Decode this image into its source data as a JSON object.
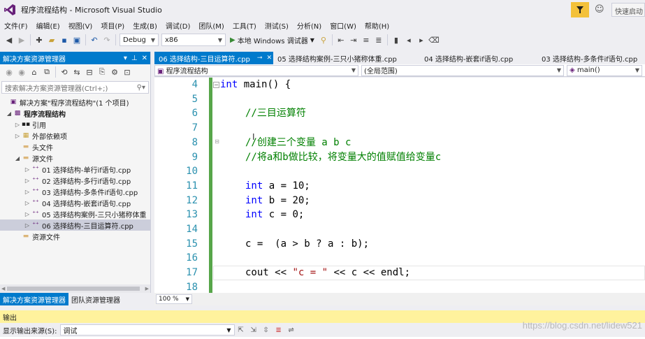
{
  "window": {
    "title": "程序流程结构 - Microsoft Visual Studio",
    "quick_launch": "快速启动"
  },
  "menu": [
    "文件(F)",
    "编辑(E)",
    "视图(V)",
    "项目(P)",
    "生成(B)",
    "调试(D)",
    "团队(M)",
    "工具(T)",
    "测试(S)",
    "分析(N)",
    "窗口(W)",
    "帮助(H)"
  ],
  "toolbar": {
    "config": "Debug",
    "platform": "x86",
    "run_label": "本地 Windows 调试器"
  },
  "solution_explorer": {
    "title": "解决方案资源管理器",
    "search_placeholder": "搜索解决方案资源管理器(Ctrl+;)",
    "solution_label": "解决方案\"程序流程结构\"(1 个项目)",
    "project_label": "程序流程结构",
    "nodes": {
      "references": "引用",
      "external": "外部依赖项",
      "headers": "头文件",
      "sources": "源文件",
      "resources": "资源文件"
    },
    "files": [
      "01 选择结构-单行if语句.cpp",
      "02 选择结构-多行if语句.cpp",
      "03 选择结构-多条件if语句.cpp",
      "04 选择结构-嵌套if语句.cpp",
      "05 选择结构案例-三只小猪称体重",
      "06 选择结构-三目运算符.cpp"
    ]
  },
  "bottom_tabs": {
    "solution": "解决方案资源管理器",
    "team": "团队资源管理器"
  },
  "doc_tabs": [
    "06 选择结构-三目运算符.cpp",
    "05 选择结构案例-三只小猪称体重.cpp",
    "04 选择结构-嵌套if语句.cpp",
    "03 选择结构-多条件if语句.cpp"
  ],
  "nav": {
    "project": "程序流程结构",
    "scope": "(全局范围)",
    "member": "main()"
  },
  "code": {
    "line_numbers": [
      "4",
      "5",
      "6",
      "7",
      "8",
      "9",
      "10",
      "11",
      "12",
      "13",
      "14",
      "15",
      "16",
      "17",
      "18"
    ],
    "l4_kw": "int",
    "l4_rest": " main() {",
    "l6": "//三目运算符",
    "l8": "//创建三个变量 a b c",
    "l9": "//将a和b做比较，将变量大的值赋值给变量c",
    "l11_kw": "int",
    "l11_rest": " a = 10;",
    "l12_kw": "int",
    "l12_rest": " b = 20;",
    "l13_kw": "int",
    "l13_rest": " c = 0;",
    "l15": "c =  (a > b ? a : b);",
    "l17_a": "cout << ",
    "l17_str": "\"c = \"",
    "l17_b": " << c << endl;"
  },
  "zoom": "100 %",
  "output": {
    "title": "输出",
    "source_label": "显示输出来源(S):",
    "source_value": "调试"
  },
  "watermark": "https://blog.csdn.net/lidew521",
  "colors": {
    "accent": "#007ACC",
    "keyword": "#0000FF",
    "comment": "#008000",
    "string": "#A31515",
    "line_number": "#2B91AF",
    "change_bar": "#57A64A"
  }
}
